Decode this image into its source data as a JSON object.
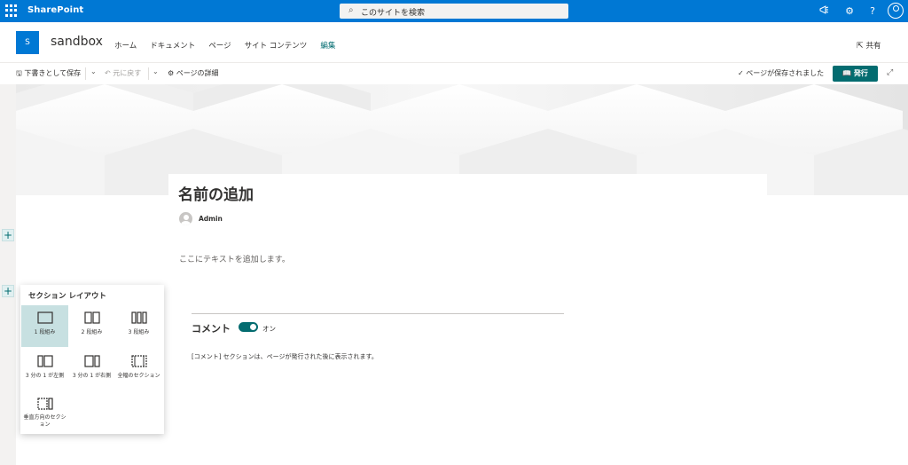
{
  "suite_bar": {
    "brand": "SharePoint",
    "search_placeholder": "このサイトを検索",
    "icons": [
      "waffle-icon",
      "search-icon",
      "megaphone-icon",
      "gear-icon",
      "help-icon",
      "user-avatar-icon"
    ],
    "color": "#0078d4"
  },
  "site_header": {
    "logo_letter": "S",
    "site_name": "sandbox",
    "nav": [
      {
        "label": "ホーム",
        "active": false
      },
      {
        "label": "ドキュメント",
        "active": false
      },
      {
        "label": "ページ",
        "active": false
      },
      {
        "label": "サイト コンテンツ",
        "active": false
      },
      {
        "label": "編集",
        "active": true
      }
    ],
    "share_label": "共有"
  },
  "command_bar": {
    "save_draft": "下書きとして保存",
    "undo": "元に戻す",
    "page_details": "ページの詳細",
    "saved_status": "ページが保存されました",
    "publish": "発行"
  },
  "page": {
    "title": "名前の追加",
    "author": "Admin",
    "text_placeholder": "ここにテキストを追加します。",
    "add_section_symbol": "+"
  },
  "comments": {
    "title": "コメント",
    "toggle_label": "オン",
    "toggle_on": true,
    "note": "[コメント] セクションは、ページが発行された後に表示されます。"
  },
  "section_layout": {
    "title": "セクション レイアウト",
    "options": [
      {
        "label": "1 段組み",
        "selected": true
      },
      {
        "label": "2 段組み",
        "selected": false
      },
      {
        "label": "3 段組み",
        "selected": false
      },
      {
        "label": "3 分の 1 が左側",
        "selected": false
      },
      {
        "label": "3 分の 1 が右側",
        "selected": false
      },
      {
        "label": "全幅のセクション",
        "selected": false
      },
      {
        "label": "垂直方向のセクション",
        "selected": false
      }
    ]
  },
  "colors": {
    "accent": "#036c70",
    "suite": "#0078d4"
  }
}
